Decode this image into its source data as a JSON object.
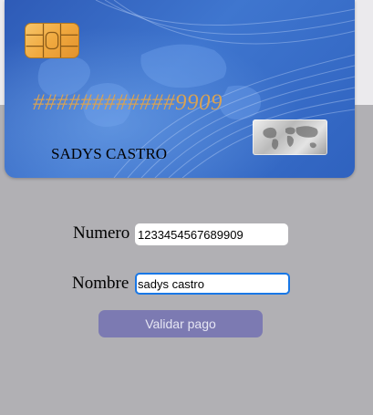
{
  "card": {
    "number": "############9909",
    "holder": "SADYS CASTRO",
    "chip_icon": "card-chip-icon",
    "hologram_icon": "world-map-hologram-icon"
  },
  "form": {
    "number_label": "Numero",
    "number_value": "1233454567689909",
    "name_label": "Nombre",
    "name_value": "sadys castro",
    "submit_label": "Validar pago"
  },
  "colors": {
    "card_blue": "#3f76cf",
    "card_number_gold": "#d6a256",
    "page_gray": "#b1b0b4",
    "button": "#7c7ab2",
    "focus_border": "#1877e6"
  }
}
